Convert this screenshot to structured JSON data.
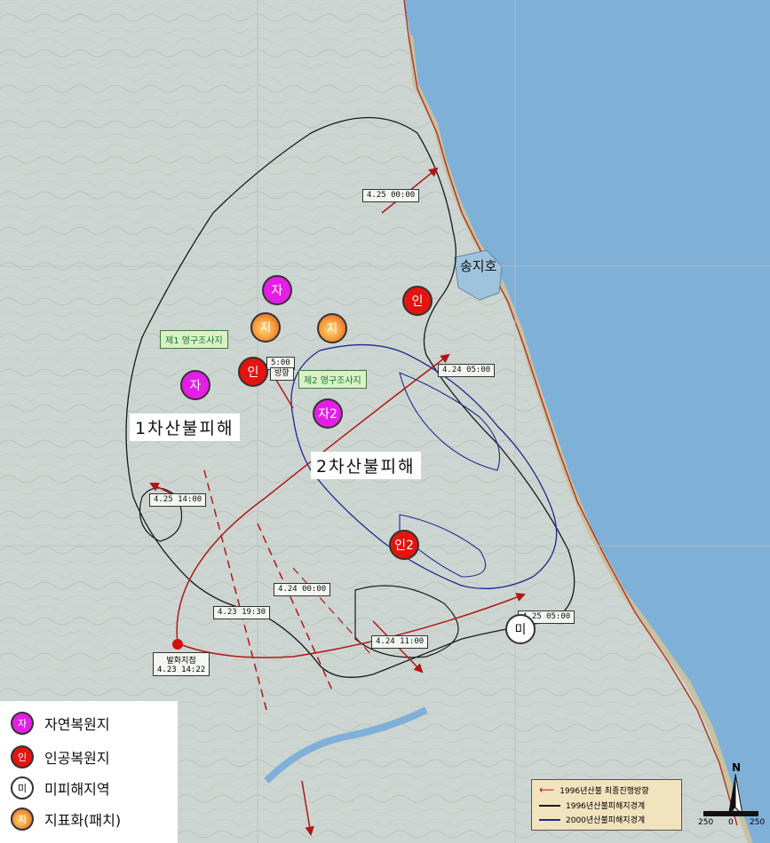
{
  "lake_label": "송지호",
  "damage_labels": {
    "first": "1차산불피해",
    "second": "2차산불피해"
  },
  "survey_sites": {
    "site1": "제1 영구조사지",
    "site2": "제2 영구조사지"
  },
  "time_labels": {
    "t1": "4.25 00:00",
    "t2": "4.24 05:00",
    "t3": "4.25 14:00",
    "t4": "4.24 00:00",
    "t5": "4.23 19:30",
    "t6": "4.24 11:00",
    "t7": "4.25 05:00",
    "t8": "5:00",
    "t8b": "방향"
  },
  "origin": {
    "title": "발화지점",
    "time": "4.23 14:22"
  },
  "markers": {
    "natural": "자",
    "natural2": "자2",
    "artificial": "인",
    "artificial2": "인2",
    "unburned": "미",
    "patch": "지"
  },
  "legend": [
    {
      "symbol": "자",
      "label": "자연복원지"
    },
    {
      "symbol": "인",
      "label": "인공복원지"
    },
    {
      "symbol": "미",
      "label": "미피해지역"
    },
    {
      "symbol": "지",
      "label": "지표화(패치)"
    }
  ],
  "line_legend": [
    "1996년산불 최종진행방향",
    "1996년산불피해지경계",
    "2000년산불피해지경계"
  ],
  "north": "N",
  "scale": [
    "250",
    "0",
    "250"
  ],
  "colors": {
    "natural": "#e41ee6",
    "artificial": "#e41410",
    "sea": "#7fb0d8",
    "land": "#ccd5d2",
    "fire_path": "#b01818",
    "boundary_1996": "#1a1a1a",
    "boundary_2000": "#1e2a8c"
  }
}
